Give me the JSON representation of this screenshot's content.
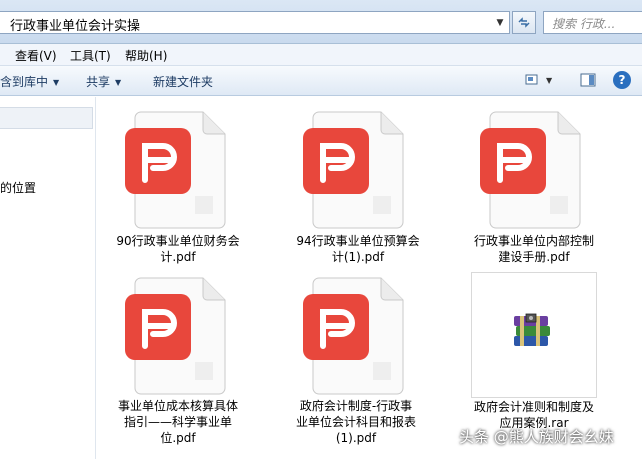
{
  "address": {
    "path": "行政事业单位会计实操",
    "search_placeholder": "搜索 行政..."
  },
  "menu": [
    "查看(V)",
    "工具(T)",
    "帮助(H)"
  ],
  "toolbar": {
    "include_library": "包含到库中",
    "share": "共享",
    "new_folder": "新建文件夹"
  },
  "sidebar": {
    "item": "的位置"
  },
  "files": [
    {
      "name_lines": [
        "90行政事业单位财务会",
        "计.pdf"
      ],
      "type": "pdf"
    },
    {
      "name_lines": [
        "94行政事业单位预算会",
        "计(1).pdf"
      ],
      "type": "pdf"
    },
    {
      "name_lines": [
        "行政事业单位内部控制",
        "建设手册.pdf"
      ],
      "type": "pdf"
    },
    {
      "name_lines": [
        "事业单位成本核算具体",
        "指引——科学事业单",
        "位.pdf"
      ],
      "type": "pdf"
    },
    {
      "name_lines": [
        "政府会计制度-行政事",
        "业单位会计科目和报表",
        "(1).pdf"
      ],
      "type": "pdf"
    },
    {
      "name_lines": [
        "政府会计准则和制度及",
        "应用案例.rar"
      ],
      "type": "rar"
    }
  ],
  "watermark": "头条 @熊人族财会幺妹",
  "colors": {
    "pdf_red": "#e8473c",
    "toolbar_bg": "#dfe9f5",
    "rar_purple": "#6a3fa0"
  }
}
